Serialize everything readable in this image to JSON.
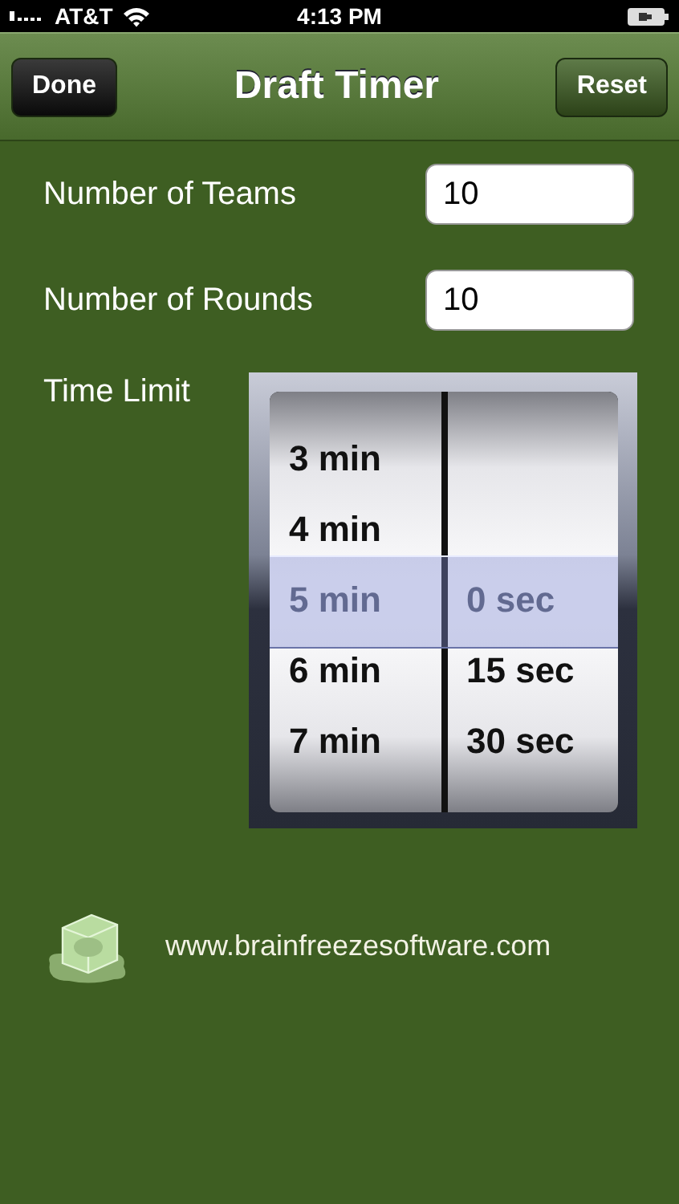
{
  "status_bar": {
    "carrier": "AT&T",
    "time": "4:13 PM"
  },
  "nav_bar": {
    "title": "Draft Timer",
    "left_button": "Done",
    "right_button": "Reset"
  },
  "fields": [
    {
      "label": "Number of Teams",
      "value": "10"
    },
    {
      "label": "Number of Rounds",
      "value": "10"
    }
  ],
  "time_limit": {
    "label": "Time Limit",
    "columns": [
      {
        "items": [
          {
            "text": "3 min",
            "selected": false
          },
          {
            "text": "4 min",
            "selected": false
          },
          {
            "text": "5 min",
            "selected": true
          },
          {
            "text": "6 min",
            "selected": false
          },
          {
            "text": "7 min",
            "selected": false
          }
        ]
      },
      {
        "items": [
          {
            "text": "0 sec",
            "selected": true
          },
          {
            "text": "15 sec",
            "selected": false
          },
          {
            "text": "30 sec",
            "selected": false
          }
        ]
      }
    ]
  },
  "footer": {
    "link": "www.brainfreezesoftware.com"
  }
}
